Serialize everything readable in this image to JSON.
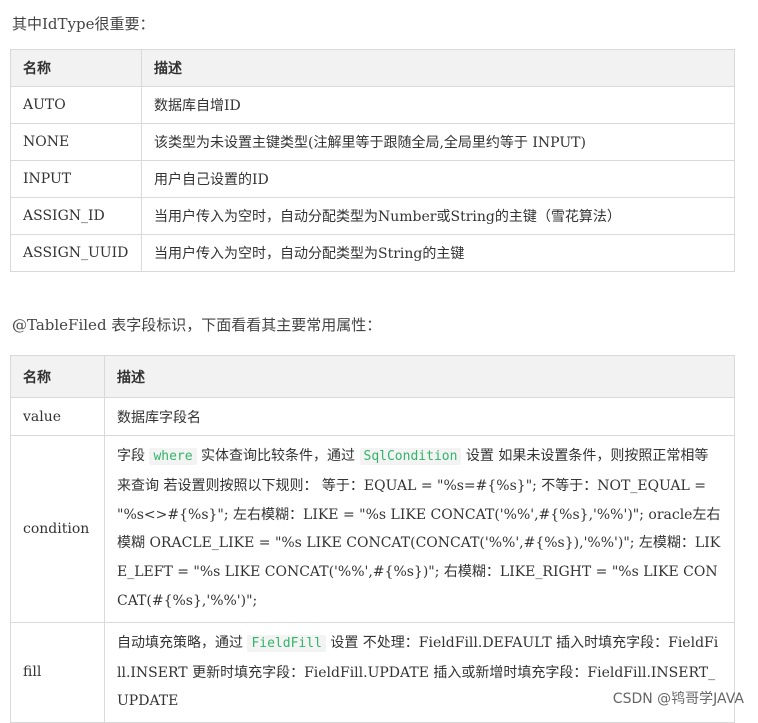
{
  "intro1": "其中IdType很重要：",
  "table1": {
    "headers": [
      "名称",
      "描述"
    ],
    "rows": [
      {
        "name": "AUTO",
        "desc": "数据库自增ID"
      },
      {
        "name": "NONE",
        "desc": "该类型为未设置主键类型(注解里等于跟随全局,全局里约等于 INPUT)"
      },
      {
        "name": "INPUT",
        "desc": "用户自己设置的ID"
      },
      {
        "name": "ASSIGN_ID",
        "desc": "当用户传入为空时，自动分配类型为Number或String的主键（雪花算法）"
      },
      {
        "name": "ASSIGN_UUID",
        "desc": "当用户传入为空时，自动分配类型为String的主键"
      }
    ]
  },
  "intro2": "@TableFiled 表字段标识，下面看看其主要常用属性：",
  "table2": {
    "headers": [
      "名称",
      "描述"
    ],
    "value": {
      "name": "value",
      "desc": "数据库字段名"
    },
    "condition": {
      "name": "condition",
      "p1": "字段",
      "code1": "where",
      "p2": "实体查询比较条件，通过",
      "code2": "SqlCondition",
      "p3": "设置 如果未设置条件，则按照正常相等来查询 若设置则按照以下规则： 等于：EQUAL = \"%s=#{%s}\"; 不等于：NOT_EQUAL = \"%s<>#{%s}\"; 左右模糊：LIKE = \"%s LIKE CONCAT('%%',#{%s},'%%')\"; oracle左右模糊 ORACLE_LIKE = \"%s LIKE CONCAT(CONCAT('%%',#{%s}),'%%')\"; 左模糊：LIKE_LEFT = \"%s LIKE CONCAT('%%',#{%s})\"; 右模糊：LIKE_RIGHT = \"%s LIKE CONCAT(#{%s},'%%')\";"
    },
    "fill": {
      "name": "fill",
      "p1": "自动填充策略，通过",
      "code1": "FieldFill",
      "p2": "设置 不处理：FieldFill.DEFAULT 插入时填充字段：FieldFill.INSERT 更新时填充字段：FieldFill.UPDATE 插入或新增时填充字段：FieldFill.INSERT_UPDATE"
    }
  },
  "watermark": "CSDN @鸨哥学JAVA"
}
